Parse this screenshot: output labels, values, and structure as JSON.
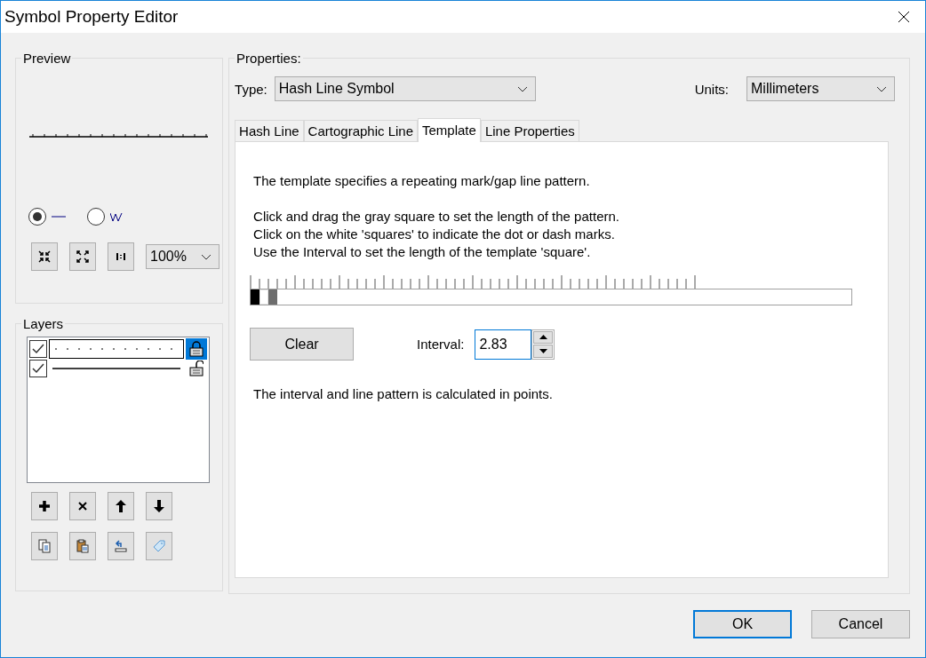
{
  "window": {
    "title": "Symbol Property Editor"
  },
  "preview": {
    "legend": "Preview",
    "views": [
      {
        "kind": "straight",
        "selected": true
      },
      {
        "kind": "zigzag",
        "selected": false
      }
    ],
    "zoom": "100%"
  },
  "layers": {
    "legend": "Layers",
    "items": [
      {
        "kind": "hash",
        "checked": true,
        "selected": true,
        "locked": true
      },
      {
        "kind": "line",
        "checked": true,
        "selected": false,
        "locked": false
      }
    ]
  },
  "properties": {
    "legend": "Properties:",
    "type_label": "Type:",
    "type_value": "Hash Line Symbol",
    "units_label": "Units:",
    "units_value": "Millimeters",
    "tabs": [
      {
        "label": "Hash Line",
        "selected": false
      },
      {
        "label": "Cartographic Line",
        "selected": false
      },
      {
        "label": "Template",
        "selected": true
      },
      {
        "label": "Line Properties",
        "selected": false
      }
    ],
    "template": {
      "intro": "The template specifies a repeating mark/gap line pattern.",
      "instructions": [
        "Click and drag the gray square to set the length of the pattern.",
        "Click on the white 'squares' to indicate the dot or dash marks.",
        "Use the Interval to set the length of the template 'square'."
      ],
      "squares": [
        {
          "marked": true
        },
        {
          "marked": false
        }
      ],
      "clear_button": "Clear",
      "interval_label": "Interval:",
      "interval_value": "2.83",
      "note": "The interval and line pattern is calculated in points."
    }
  },
  "buttons": [
    {
      "label": "OK",
      "default": true
    },
    {
      "label": "Cancel",
      "default": false
    }
  ]
}
